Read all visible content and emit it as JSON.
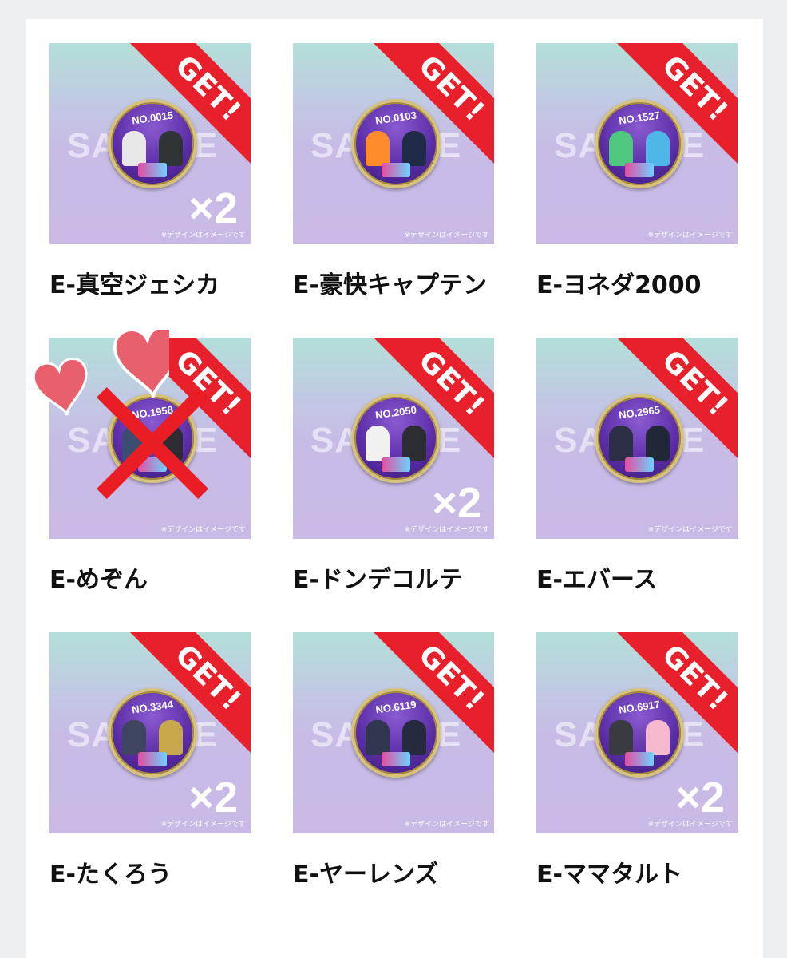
{
  "items": [
    {
      "name": "E-真空ジェシカ",
      "coin_no": "NO.0015",
      "badge": "GET!",
      "watermark": "SAMPLE",
      "caption": "※デザインはイメージです",
      "count": "×2",
      "figure_colors": [
        "#e8e8e8",
        "#2f3436"
      ]
    },
    {
      "name": "E-豪快キャプテン",
      "coin_no": "NO.0103",
      "badge": "GET!",
      "watermark": "SAMPLE",
      "caption": "※デザインはイメージです",
      "count": "",
      "figure_colors": [
        "#ff8b2b",
        "#1f2b47"
      ]
    },
    {
      "name": "E-ヨネダ2000",
      "coin_no": "NO.1527",
      "badge": "GET!",
      "watermark": "SAMPLE",
      "caption": "※デザインはイメージです",
      "count": "",
      "figure_colors": [
        "#4fc77f",
        "#4fb7e7"
      ]
    },
    {
      "name": "E-めぞん",
      "coin_no": "NO.1958",
      "badge": "GET!",
      "watermark": "SAMPLE",
      "caption": "※デザインはイメージです",
      "count": "",
      "figure_colors": [
        "#3c4d72",
        "#2e2b33"
      ],
      "crossed_out": true,
      "hearts": true
    },
    {
      "name": "E-ドンデコルテ",
      "coin_no": "NO.2050",
      "badge": "GET!",
      "watermark": "SAMPLE",
      "caption": "※デザインはイメージです",
      "count": "×2",
      "figure_colors": [
        "#f1f1f1",
        "#2c2c33"
      ]
    },
    {
      "name": "E-エバース",
      "coin_no": "NO.2965",
      "badge": "GET!",
      "watermark": "SAMPLE",
      "caption": "※デザインはイメージです",
      "count": "",
      "figure_colors": [
        "#2c2f45",
        "#202838"
      ]
    },
    {
      "name": "E-たくろう",
      "coin_no": "NO.3344",
      "badge": "GET!",
      "watermark": "SAMPLE",
      "caption": "※デザインはイメージです",
      "count": "×2",
      "figure_colors": [
        "#3e455e",
        "#c7a84c"
      ]
    },
    {
      "name": "E-ヤーレンズ",
      "coin_no": "NO.6119",
      "badge": "GET!",
      "watermark": "SAMPLE",
      "caption": "※デザインはイメージです",
      "count": "",
      "figure_colors": [
        "#2f3650",
        "#252a3e"
      ]
    },
    {
      "name": "E-ママタルト",
      "coin_no": "NO.6917",
      "badge": "GET!",
      "watermark": "SAMPLE",
      "caption": "※デザインはイメージです",
      "count": "×2",
      "figure_colors": [
        "#393b41",
        "#f6b8cc"
      ]
    }
  ],
  "colors": {
    "badge_red": "#e8202b",
    "thumb_top": "#b3e0d8",
    "thumb_bottom": "#c9b9e6",
    "cross_red": "#ea1d24",
    "heart_pink": "#e9606d"
  }
}
